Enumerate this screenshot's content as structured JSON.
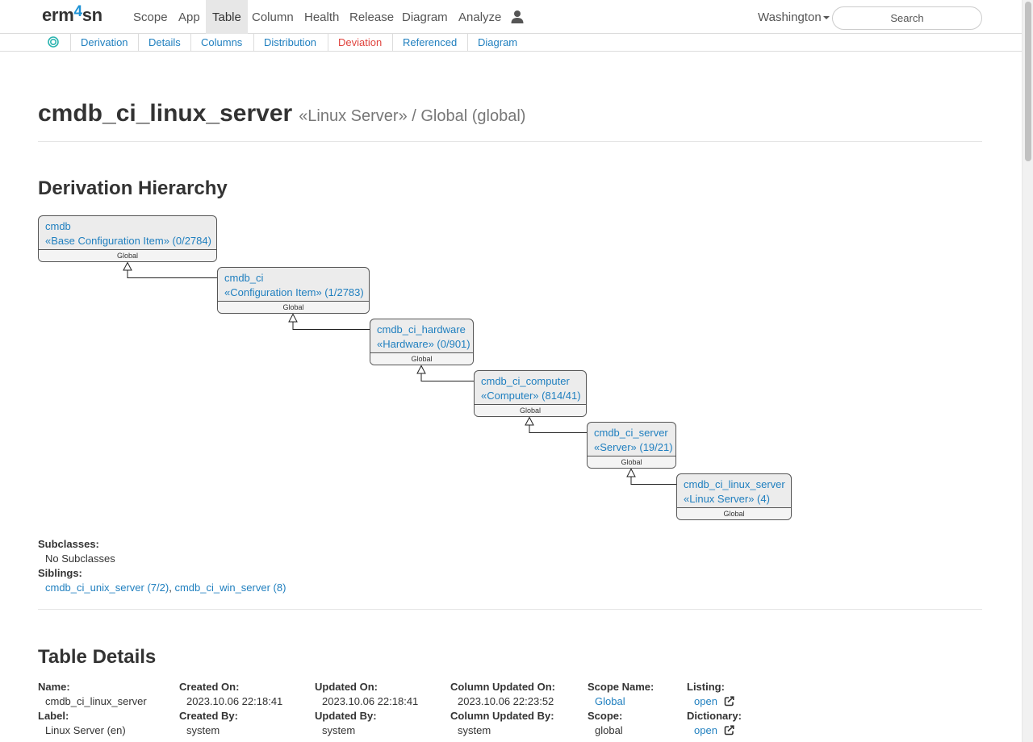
{
  "navbar": {
    "brand_prefix": "erm",
    "brand_accent": "4",
    "brand_suffix": "sn",
    "items": [
      {
        "label": "Scope",
        "active": false
      },
      {
        "label": "App",
        "active": false
      },
      {
        "label": "Table",
        "active": true
      },
      {
        "label": "Column",
        "active": false
      },
      {
        "label": "Health",
        "active": false
      },
      {
        "label": "Release",
        "active": false
      },
      {
        "label": "Diagram",
        "active": false
      },
      {
        "label": "Analyze",
        "active": false
      }
    ],
    "user_icon": "person-icon",
    "instance": "Washington",
    "search_placeholder": "Search"
  },
  "subnav": {
    "home_icon": "target-icon",
    "items": [
      {
        "label": "Derivation",
        "active": false
      },
      {
        "label": "Details",
        "active": false
      },
      {
        "label": "Columns",
        "active": false
      },
      {
        "label": "Distribution",
        "active": false
      },
      {
        "label": "Deviation",
        "active": true
      },
      {
        "label": "Referenced",
        "active": false
      },
      {
        "label": "Diagram",
        "active": false
      }
    ]
  },
  "header": {
    "title": "cmdb_ci_linux_server",
    "subtitle": "«Linux Server» / Global (global)"
  },
  "derivation": {
    "heading": "Derivation Hierarchy",
    "nodes": [
      {
        "name": "cmdb",
        "label": "«Base Configuration Item» (0/2784)",
        "scope": "Global"
      },
      {
        "name": "cmdb_ci",
        "label": "«Configuration Item» (1/2783)",
        "scope": "Global"
      },
      {
        "name": "cmdb_ci_hardware",
        "label": "«Hardware» (0/901)",
        "scope": "Global"
      },
      {
        "name": "cmdb_ci_computer",
        "label": "«Computer» (814/41)",
        "scope": "Global"
      },
      {
        "name": "cmdb_ci_server",
        "label": "«Server» (19/21)",
        "scope": "Global"
      },
      {
        "name": "cmdb_ci_linux_server",
        "label": "«Linux Server» (4)",
        "scope": "Global"
      }
    ],
    "subclasses_label": "Subclasses:",
    "subclasses_value": "No Subclasses",
    "siblings_label": "Siblings:",
    "siblings": [
      "cmdb_ci_unix_server (7/2)",
      "cmdb_ci_win_server (8)"
    ],
    "siblings_separator": ","
  },
  "details": {
    "heading": "Table Details",
    "fields": [
      {
        "label": "Name:",
        "value": "cmdb_ci_linux_server",
        "link": false
      },
      {
        "label": "Label:",
        "value": "Linux Server (en)",
        "link": false
      },
      {
        "label": "Created On:",
        "value": "2023.10.06 22:18:41",
        "link": false
      },
      {
        "label": "Created By:",
        "value": "system",
        "link": false
      },
      {
        "label": "Updated On:",
        "value": "2023.10.06 22:18:41",
        "link": false
      },
      {
        "label": "Updated By:",
        "value": "system",
        "link": false
      },
      {
        "label": "Column Updated On:",
        "value": "2023.10.06 22:23:52",
        "link": false
      },
      {
        "label": "Column Updated By:",
        "value": "system",
        "link": false
      },
      {
        "label": "Scope Name:",
        "value": "Global",
        "link": true
      },
      {
        "label": "Scope:",
        "value": "global",
        "link": false
      },
      {
        "label": "Listing:",
        "value": "open",
        "link": true
      },
      {
        "label": "Dictionary:",
        "value": "open",
        "link": true
      }
    ]
  },
  "colors": {
    "link": "#1f7fbf",
    "active_subnav": "#e0443e",
    "brand_accent": "#1f93d6",
    "node_fill": "#ececec"
  }
}
